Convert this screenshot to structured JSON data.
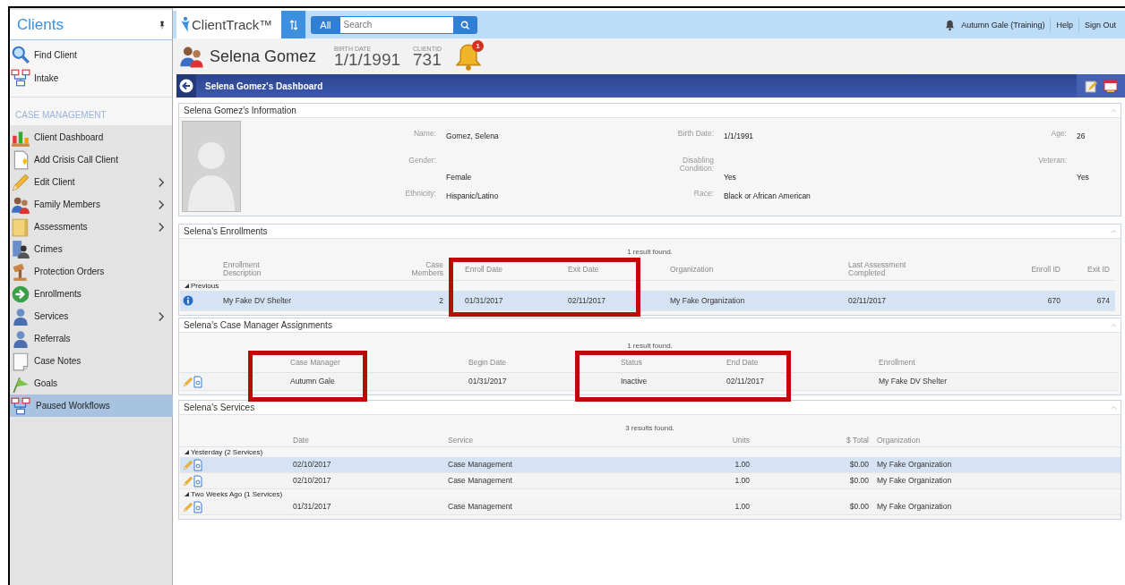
{
  "top_bar": {
    "logo": "ClientTrack™",
    "search_scope": "All",
    "search": {
      "placeholder": "Search"
    },
    "user": "Autumn Gale (Training)",
    "links": [
      "Help",
      "Sign Out"
    ]
  },
  "sidebar": {
    "title": "Clients",
    "top_items": [
      {
        "label": "Find Client"
      },
      {
        "label": "Intake"
      }
    ],
    "section_title": "CASE MANAGEMENT",
    "items": [
      {
        "label": "Client Dashboard",
        "has_submenu": false,
        "selected": false
      },
      {
        "label": "Add Crisis Call Client",
        "has_submenu": false,
        "selected": false
      },
      {
        "label": "Edit Client",
        "has_submenu": true,
        "selected": false
      },
      {
        "label": "Family Members",
        "has_submenu": true,
        "selected": false
      },
      {
        "label": "Assessments",
        "has_submenu": true,
        "selected": false
      },
      {
        "label": "Crimes",
        "has_submenu": false,
        "selected": false
      },
      {
        "label": "Protection Orders",
        "has_submenu": false,
        "selected": false
      },
      {
        "label": "Enrollments",
        "has_submenu": false,
        "selected": false
      },
      {
        "label": "Services",
        "has_submenu": true,
        "selected": false
      },
      {
        "label": "Referrals",
        "has_submenu": false,
        "selected": false
      },
      {
        "label": "Case Notes",
        "has_submenu": false,
        "selected": false
      },
      {
        "label": "Goals",
        "has_submenu": false,
        "selected": false
      },
      {
        "label": "Paused Workflows",
        "has_submenu": false,
        "selected": true
      }
    ]
  },
  "client_header": {
    "name": "Selena Gomez",
    "birth_date_label": "BIRTH DATE",
    "birth_date": "1/1/1991",
    "client_id_label": "CLIENTID",
    "client_id": "731",
    "notification_count": "1"
  },
  "dashboard_bar": {
    "title": "Selena Gomez's Dashboard"
  },
  "info_panel": {
    "title": "Selena Gomez's Information",
    "fields": [
      {
        "label": "Name:",
        "value": "Gomez, Selena"
      },
      {
        "label": "Birth Date:",
        "value": "1/1/1991"
      },
      {
        "label": "Age:",
        "value": "26"
      },
      {
        "label": "Gender:",
        "value": "Female"
      },
      {
        "label": "Disabling\nCondition:",
        "value": "Yes"
      },
      {
        "label": "Veteran:",
        "value": "Yes"
      },
      {
        "label": "Ethnicity:",
        "value": "Hispanic/Latino"
      },
      {
        "label": "Race:",
        "value": "Black or African American"
      }
    ]
  },
  "enrollments": {
    "title": "Selena's Enrollments",
    "result_text": "1 result found.",
    "columns": [
      {
        "label": "Enrollment\nDescription",
        "highlighted": false
      },
      {
        "label": "Case\nMembers",
        "highlighted": false
      },
      {
        "label": "Enroll Date",
        "highlighted": true
      },
      {
        "label": "Exit Date",
        "highlighted": true
      },
      {
        "label": "Organization",
        "highlighted": false
      },
      {
        "label": "Last Assessment\nCompleted",
        "highlighted": false
      },
      {
        "label": "Enroll ID",
        "highlighted": false
      },
      {
        "label": "Exit ID",
        "highlighted": false
      }
    ],
    "groups": [
      {
        "label": "Previous",
        "expanded": true,
        "rows": [
          {
            "kind": "info",
            "cells": [
              "My Fake DV Shelter",
              "2",
              "01/31/2017",
              "02/11/2017",
              "My Fake Organization",
              "02/11/2017",
              "670",
              "674"
            ],
            "selected": true
          }
        ]
      }
    ]
  },
  "case_managers": {
    "title": "Selena's Case Manager Assignments",
    "result_text": "1 result found.",
    "columns": [
      {
        "label": "Case Manager",
        "highlighted": true
      },
      {
        "label": "Begin Date",
        "highlighted": false
      },
      {
        "label": "Status",
        "highlighted": true
      },
      {
        "label": "End Date",
        "highlighted": true
      },
      {
        "label": "Enrollment",
        "highlighted": false
      }
    ],
    "rows": [
      {
        "kind": "edit",
        "cells": [
          "Autumn Gale",
          "01/31/2017",
          "Inactive",
          "02/11/2017",
          "My Fake DV Shelter"
        ],
        "selected": false
      }
    ]
  },
  "services": {
    "title": "Selena's Services",
    "result_text": "3 results found.",
    "columns": [
      {
        "label": "Date",
        "highlighted": false
      },
      {
        "label": "Service",
        "highlighted": false
      },
      {
        "label": "Units",
        "highlighted": false
      },
      {
        "label": "$ Total",
        "highlighted": false
      },
      {
        "label": "Organization",
        "highlighted": false
      }
    ],
    "groups": [
      {
        "label": "Yesterday (2 Services)",
        "expanded": true,
        "rows": [
          {
            "kind": "edit",
            "cells": [
              "02/10/2017",
              "Case Management",
              "1.00",
              "$0.00",
              "My Fake Organization"
            ],
            "selected": true
          },
          {
            "kind": "edit",
            "cells": [
              "02/10/2017",
              "Case Management",
              "1.00",
              "$0.00",
              "My Fake Organization"
            ],
            "selected": false
          }
        ]
      },
      {
        "label": "Two Weeks Ago (1 Services)",
        "expanded": true,
        "rows": [
          {
            "kind": "edit",
            "cells": [
              "01/31/2017",
              "Case Management",
              "1.00",
              "$0.00",
              "My Fake Organization"
            ],
            "selected": false
          }
        ]
      }
    ]
  }
}
